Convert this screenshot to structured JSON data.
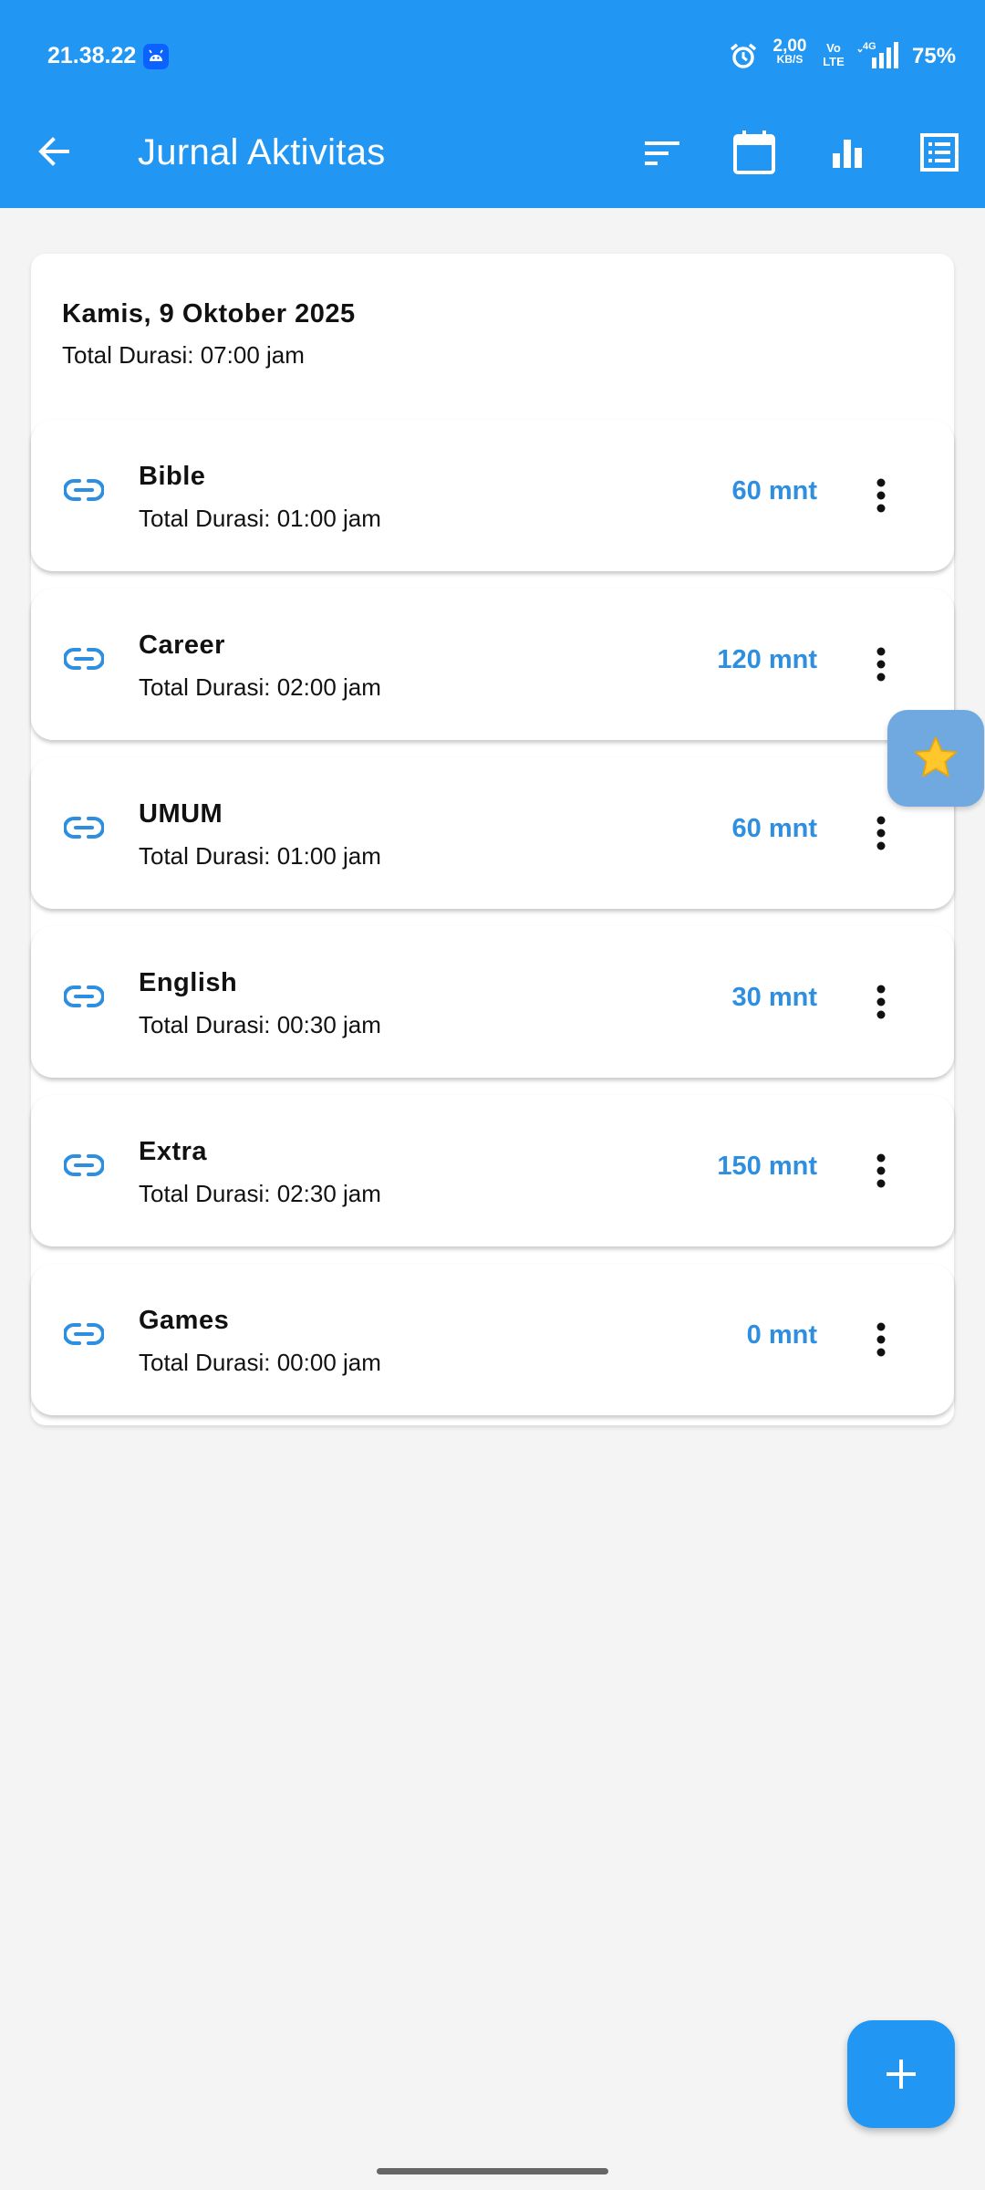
{
  "status_bar": {
    "time": "21.38.22",
    "net_speed": "2,00",
    "net_speed_unit": "KB/S",
    "volte_top": "Vo",
    "volte_bottom": "LTE",
    "network_type": "4G",
    "battery": "75%",
    "icons": [
      "android-notification-icon",
      "alarm-icon",
      "signal-icon"
    ]
  },
  "app_bar": {
    "title": "Jurnal Aktivitas",
    "icons": [
      "back-arrow-icon",
      "sort-icon",
      "calendar-icon",
      "bar-chart-icon",
      "list-icon"
    ],
    "color": "#2196f3"
  },
  "day": {
    "date": "Kamis, 9 Oktober 2025",
    "total": "Total Durasi: 07:00 jam"
  },
  "items": [
    {
      "name": "Bible",
      "total": "Total Durasi: 01:00 jam",
      "minutes": "60 mnt"
    },
    {
      "name": "Career",
      "total": "Total Durasi: 02:00 jam",
      "minutes": "120 mnt"
    },
    {
      "name": "UMUM",
      "total": "Total Durasi: 01:00 jam",
      "minutes": "60 mnt"
    },
    {
      "name": "English",
      "total": "Total Durasi: 00:30 jam",
      "minutes": "30 mnt"
    },
    {
      "name": "Extra",
      "total": "Total Durasi: 02:30 jam",
      "minutes": "150 mnt"
    },
    {
      "name": "Games",
      "total": "Total Durasi: 00:00 jam",
      "minutes": "0 mnt"
    }
  ],
  "fabs": {
    "star_icon": "star-icon",
    "add_icon": "plus-icon"
  },
  "accent_color": "#2e8ee0"
}
